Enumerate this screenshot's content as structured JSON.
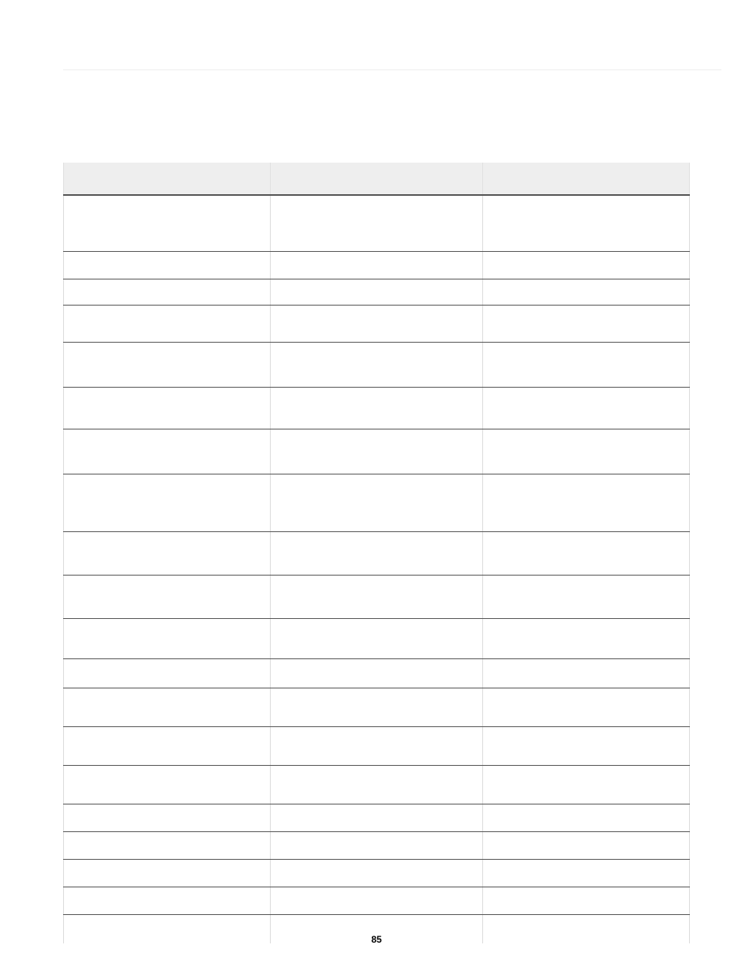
{
  "footer": {
    "page_number": "85"
  },
  "table": {
    "headers": [
      "",
      "",
      ""
    ],
    "rows": [
      {
        "h": "h-70",
        "cells": [
          "",
          "",
          ""
        ]
      },
      {
        "h": "h-34",
        "cells": [
          "",
          "",
          ""
        ]
      },
      {
        "h": "h-32",
        "cells": [
          "",
          "",
          ""
        ]
      },
      {
        "h": "h-46",
        "cells": [
          "",
          "",
          ""
        ]
      },
      {
        "h": "h-56",
        "cells": [
          "",
          "",
          ""
        ]
      },
      {
        "h": "h-52",
        "cells": [
          "",
          "",
          ""
        ]
      },
      {
        "h": "h-56",
        "cells": [
          "",
          "",
          ""
        ]
      },
      {
        "h": "h-72",
        "cells": [
          "",
          "",
          ""
        ]
      },
      {
        "h": "h-54",
        "cells": [
          "",
          "",
          ""
        ]
      },
      {
        "h": "h-54",
        "cells": [
          "",
          "",
          ""
        ]
      },
      {
        "h": "h-50",
        "cells": [
          "",
          "",
          ""
        ]
      },
      {
        "h": "h-36",
        "cells": [
          "",
          "",
          ""
        ]
      },
      {
        "h": "h-48",
        "cells": [
          "",
          "",
          ""
        ]
      },
      {
        "h": "h-48",
        "cells": [
          "",
          "",
          ""
        ]
      },
      {
        "h": "h-48",
        "cells": [
          "",
          "",
          ""
        ]
      },
      {
        "h": "h-34",
        "cells": [
          "",
          "",
          ""
        ]
      },
      {
        "h": "h-34",
        "cells": [
          "",
          "",
          ""
        ]
      },
      {
        "h": "h-34",
        "cells": [
          "",
          "",
          ""
        ]
      },
      {
        "h": "h-34",
        "cells": [
          "",
          "",
          ""
        ]
      },
      {
        "h": "h-last",
        "cells": [
          "",
          "",
          ""
        ]
      }
    ]
  }
}
